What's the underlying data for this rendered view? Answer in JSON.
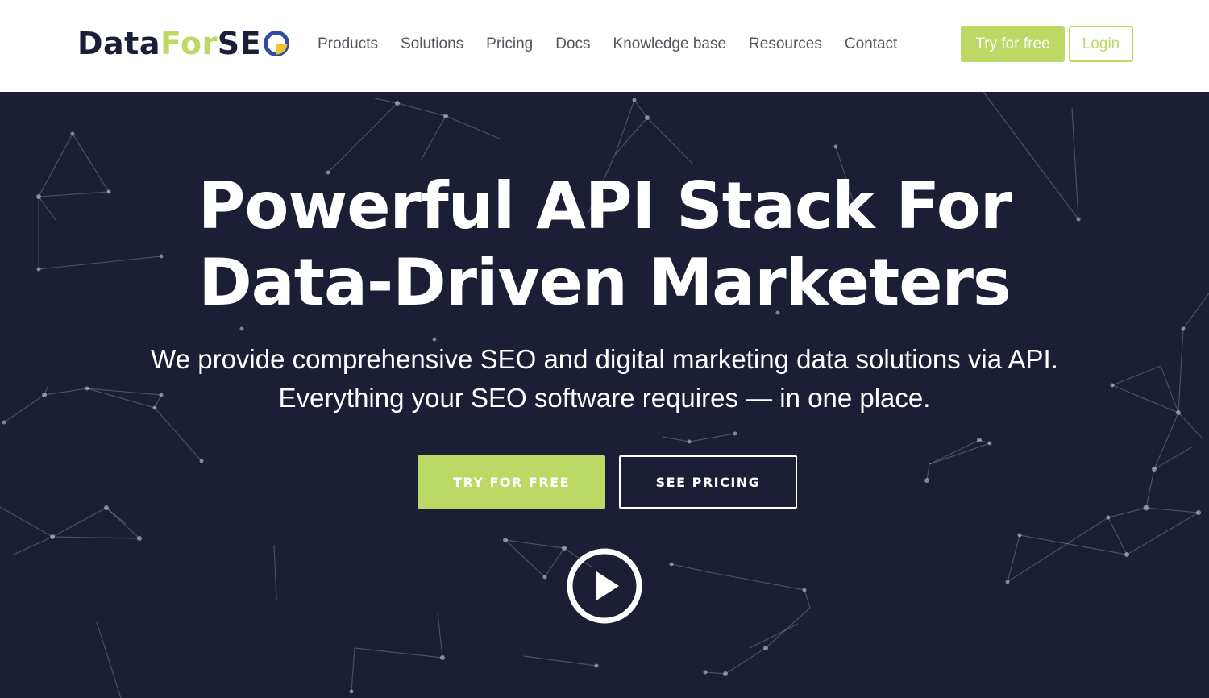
{
  "header": {
    "logo": {
      "part_a": "Data",
      "part_b": "For",
      "part_c": "SE"
    },
    "nav": [
      "Products",
      "Solutions",
      "Pricing",
      "Docs",
      "Knowledge base",
      "Resources",
      "Contact"
    ],
    "try_label": "Try for free",
    "login_label": "Login"
  },
  "hero": {
    "title_line1": "Powerful API Stack For",
    "title_line2": "Data-Driven Marketers",
    "subtitle_line1": "We provide comprehensive SEO and digital marketing data solutions via API.",
    "subtitle_line2": "Everything your SEO software requires — in one place.",
    "try_label": "TRY FOR FREE",
    "pricing_label": "SEE PRICING",
    "play_icon": "play-icon"
  },
  "colors": {
    "accent": "#bcd965",
    "navy": "#1b1e35",
    "logo_blue": "#2f4ca6",
    "logo_yellow": "#f1c232",
    "nav_text": "#55575f"
  }
}
